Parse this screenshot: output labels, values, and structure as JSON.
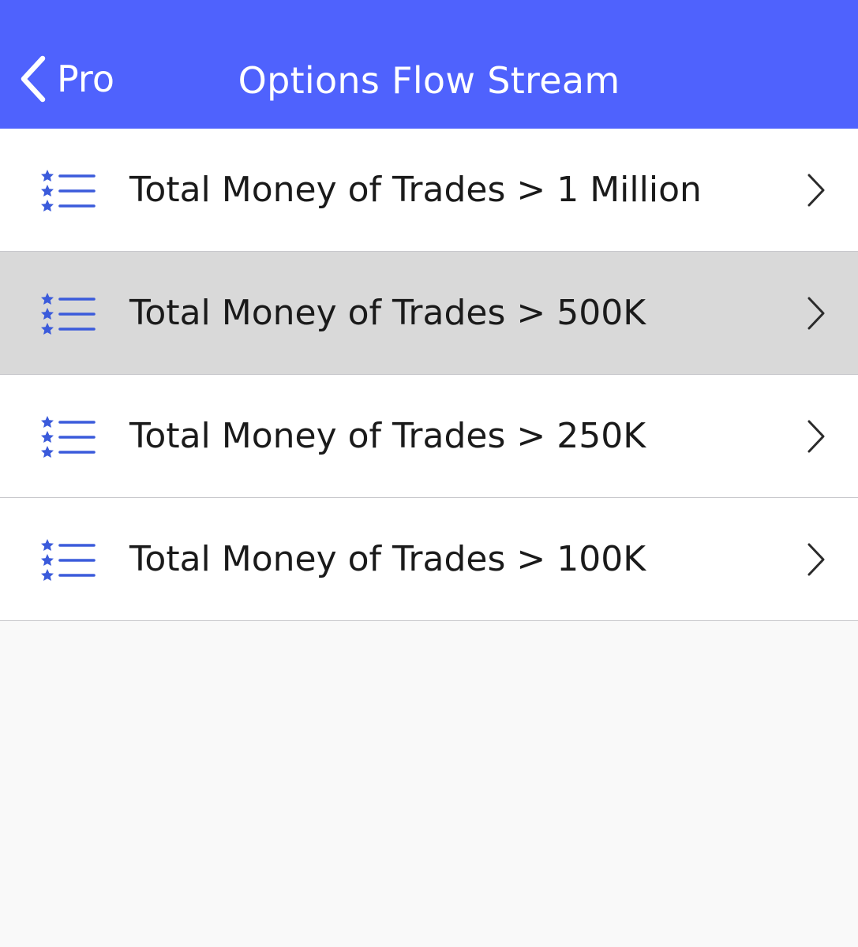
{
  "colors": {
    "accent": "#4f62fd",
    "icon_blue": "#3b5bdb",
    "row_highlight": "#d9d9d9",
    "separator": "#c8c8cc",
    "background": "#f9f9f9"
  },
  "navbar": {
    "back_label": "Pro",
    "title": "Options Flow Stream",
    "back_icon": "chevron-left-icon"
  },
  "list": {
    "items": [
      {
        "label": "Total Money of Trades > 1 Million",
        "icon": "starred-list-icon",
        "highlighted": false
      },
      {
        "label": "Total Money of Trades > 500K",
        "icon": "starred-list-icon",
        "highlighted": true
      },
      {
        "label": "Total Money of Trades > 250K",
        "icon": "starred-list-icon",
        "highlighted": false
      },
      {
        "label": "Total Money of Trades > 100K",
        "icon": "starred-list-icon",
        "highlighted": false
      }
    ]
  }
}
